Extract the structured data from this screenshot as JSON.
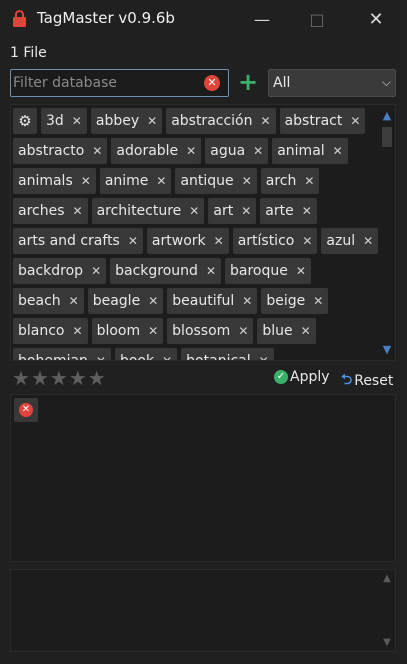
{
  "window": {
    "title": "TagMaster v0.9.6b",
    "minimize_glyph": "—",
    "maximize_glyph": "□",
    "close_glyph": "✕"
  },
  "file_count": "1 File",
  "filter": {
    "placeholder": "Filter database",
    "value": ""
  },
  "scope_select": {
    "selected": "All"
  },
  "tag_rows": [
    [
      "3d",
      "abbey",
      "abstracción",
      "abstract"
    ],
    [
      "abstracto",
      "adorable",
      "agua",
      "animal"
    ],
    [
      "animals",
      "anime",
      "antique",
      "arch"
    ],
    [
      "arches",
      "architecture",
      "art",
      "arte"
    ],
    [
      "arts and crafts",
      "artwork",
      "artístico",
      "azul"
    ],
    [
      "backdrop",
      "background",
      "baroque"
    ],
    [
      "beach",
      "beagle",
      "beautiful",
      "beige"
    ],
    [
      "blanco",
      "bloom",
      "blossom",
      "blue"
    ],
    [
      "bohemian",
      "book",
      "botanical"
    ]
  ],
  "rating": {
    "stars": 5,
    "value": 0
  },
  "actions": {
    "apply": "Apply",
    "reset": "Reset"
  },
  "colors": {
    "accent_red": "#e0453c",
    "accent_green": "#3ab06a",
    "accent_blue": "#4a8fe0"
  },
  "icons": [
    "app-lock-icon",
    "gear-icon",
    "clear-filter-icon",
    "add-icon",
    "chevron-down-icon",
    "star-icon",
    "check-icon",
    "reset-icon",
    "remove-icon"
  ]
}
